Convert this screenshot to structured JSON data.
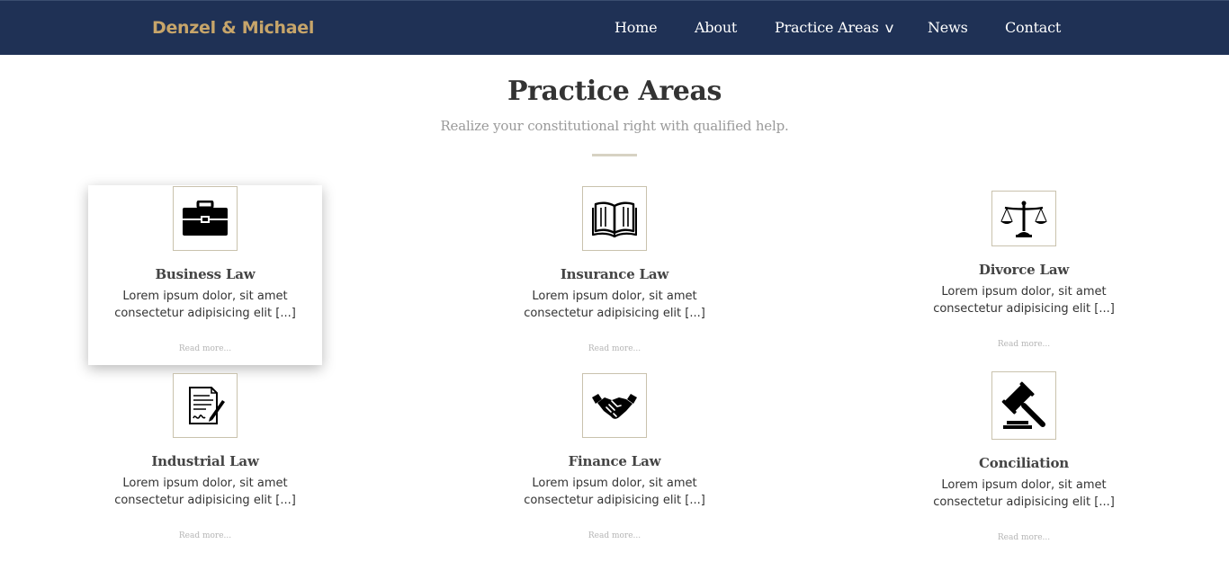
{
  "header": {
    "brand": "Denzel & Michael",
    "nav": [
      {
        "label": "Home"
      },
      {
        "label": "About"
      },
      {
        "label": "Practice Areas"
      },
      {
        "label": "News"
      },
      {
        "label": "Contact"
      }
    ],
    "dropdown_glyph": "v"
  },
  "section": {
    "title": "Practice Areas",
    "subtitle": "Realize your constitutional right with qualified help."
  },
  "cards": [
    {
      "title": "Business Law",
      "desc": "Lorem ipsum dolor, sit amet consectetur adipisicing elit [...]",
      "more": "Read more...",
      "icon": "briefcase-icon"
    },
    {
      "title": "Insurance Law",
      "desc": "Lorem ipsum dolor, sit amet consectetur adipisicing elit [...]",
      "more": "Read more...",
      "icon": "book-icon"
    },
    {
      "title": "Divorce Law",
      "desc": "Lorem ipsum dolor, sit amet consectetur adipisicing elit [...]",
      "more": "Read more...",
      "icon": "scales-icon"
    },
    {
      "title": "Industrial Law",
      "desc": "Lorem ipsum dolor, sit amet consectetur adipisicing elit [...]",
      "more": "Read more...",
      "icon": "document-pen-icon"
    },
    {
      "title": "Finance Law",
      "desc": "Lorem ipsum dolor, sit amet consectetur adipisicing elit [...]",
      "more": "Read more...",
      "icon": "handshake-icon"
    },
    {
      "title": "Conciliation",
      "desc": "Lorem ipsum dolor, sit amet consectetur adipisicing elit [...]",
      "more": "Read more...",
      "icon": "gavel-icon"
    }
  ],
  "colors": {
    "navbar": "#1f3155",
    "brand": "#c7a56a",
    "divider": "#d7d2c3"
  }
}
